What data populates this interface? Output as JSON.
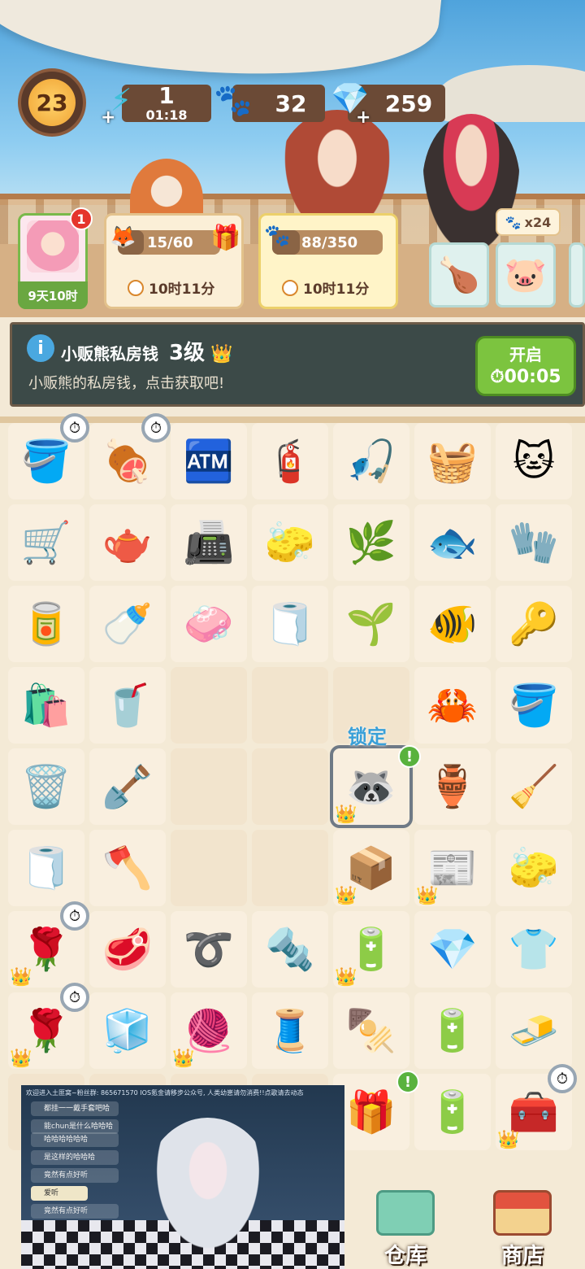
{
  "hud": {
    "level": "23",
    "energy": {
      "value": "1",
      "timer": "01:18"
    },
    "paws": "32",
    "gems": "259"
  },
  "avatar": {
    "badge": "1",
    "time": "9天10时"
  },
  "cards": {
    "fox_card": {
      "progress": "15/60",
      "progress_fraction": 0.25,
      "timer": "10时11分"
    },
    "paw_card": {
      "progress": "88/350",
      "progress_fraction": 0.25,
      "timer": "10时11分"
    },
    "boy_badge": "x24"
  },
  "banner": {
    "title": "小贩熊私房钱",
    "level": "3级",
    "subtitle": "小贩熊的私房钱，点击获取吧!",
    "button_label": "开启",
    "button_timer": "00:05"
  },
  "board": {
    "lock_label": "锁定",
    "rows": [
      [
        "🪣",
        "🍖",
        "🏧",
        "🧯",
        "🎣",
        "🧺",
        "🐱"
      ],
      [
        "🛒",
        "🫖",
        "📠",
        "🧽",
        "🌿",
        "🐟",
        "🧤"
      ],
      [
        "🥫",
        "🍼",
        "🧼",
        "🧻",
        "🌱",
        "🐠",
        "🔑"
      ],
      [
        "🛍️",
        "🥤",
        "",
        "",
        "",
        "🦀",
        "🪣"
      ],
      [
        "🗑️",
        "🪏",
        "",
        "",
        "🦝",
        "🏺",
        "🧹"
      ],
      [
        "🧻",
        "🪓",
        "",
        "",
        "📦",
        "📰",
        "🧽"
      ],
      [
        "🌹",
        "🥩",
        "➰",
        "🔩",
        "🔋",
        "💎",
        "👕"
      ],
      [
        "🌹",
        "🧊",
        "🧶",
        "🧵",
        "🍢",
        "🔋",
        "🧈"
      ],
      [
        "",
        "",
        "",
        "",
        "🎁",
        "🔋",
        "🧰"
      ]
    ]
  },
  "stream": {
    "header": "欢迎进入土匪窝~粉丝群: 865671570 IOS氪金请移步公众号, 人类幼崽请勿消费!!点歌请去动态",
    "chats": [
      "都挂一一戴手套吧哈",
      "能chun是什么哈哈哈",
      "哈哈哈哈哈哈",
      "是这样的哈哈哈",
      "竟然有点好听",
      "爱听",
      "竟然有点好听"
    ]
  },
  "bottom": {
    "warehouse": "仓库",
    "shop": "商店"
  },
  "colors": {
    "green_button": "#7cc43f",
    "banner_bg": "#3c4a48",
    "lock_blue": "#3aa0d8"
  }
}
